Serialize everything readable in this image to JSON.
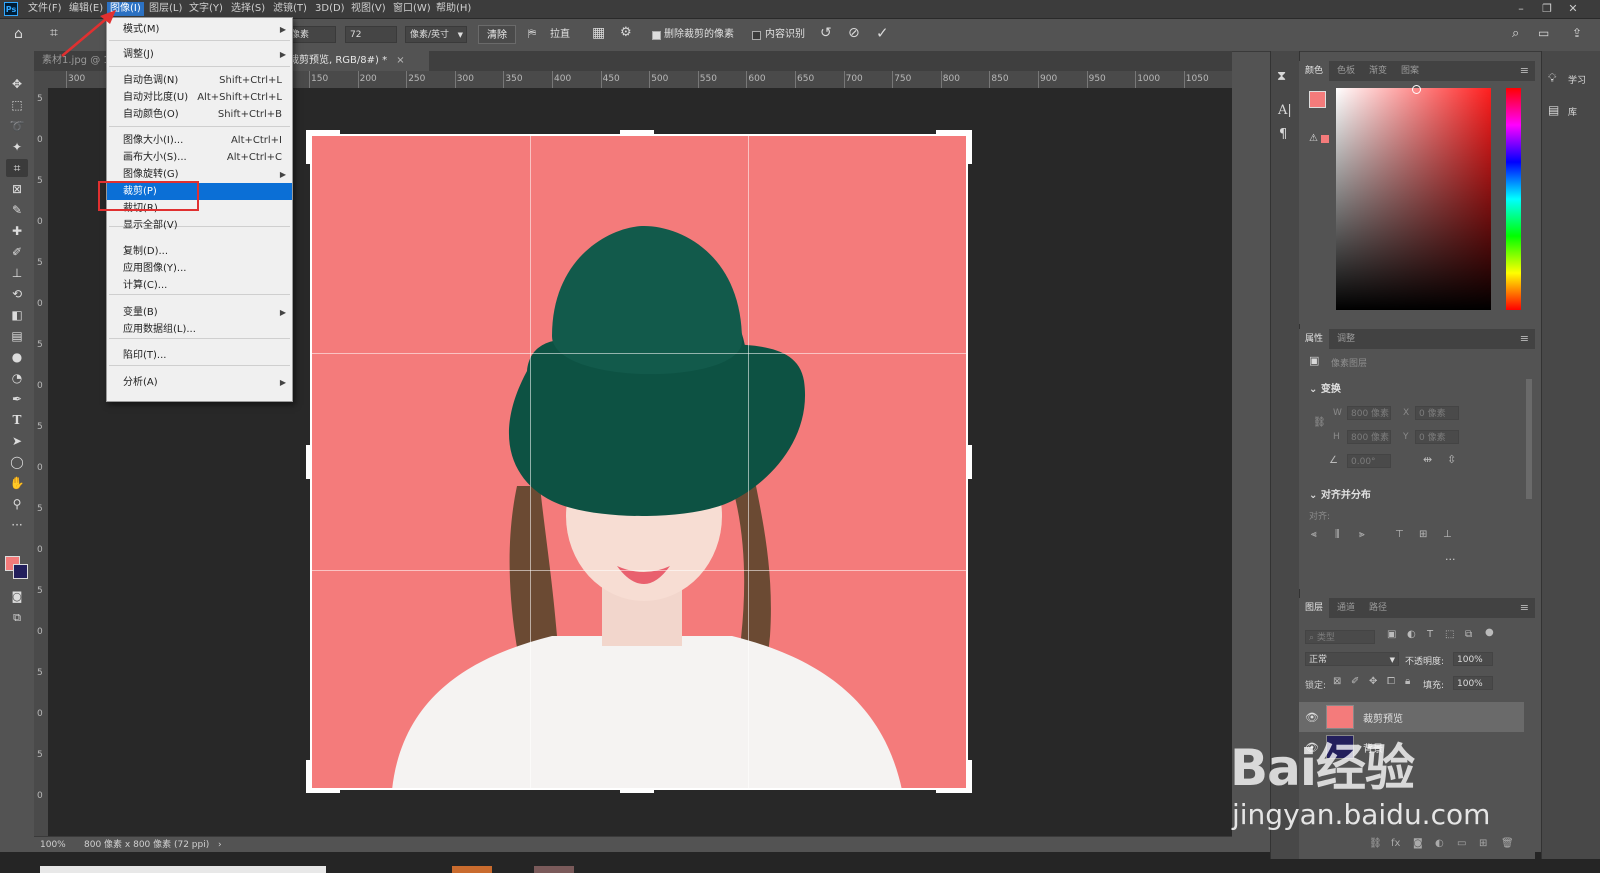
{
  "app": {
    "logo": "Ps"
  },
  "menubar": {
    "items": [
      "文件(F)",
      "编辑(E)",
      "图像(I)",
      "图层(L)",
      "文字(Y)",
      "选择(S)",
      "滤镜(T)",
      "3D(D)",
      "视图(V)",
      "窗口(W)",
      "帮助(H)"
    ],
    "active_index": 2
  },
  "options_bar": {
    "unit_field": "像素",
    "resolution": "72",
    "resolution_unit": "像素/英寸",
    "clear_label": "清除",
    "straighten_label": "拉直",
    "delete_cropped_label": "删除裁剪的像素",
    "delete_cropped_checked": true,
    "content_aware_label": "内容识别",
    "content_aware_checked": false
  },
  "doc_tabs": [
    {
      "label": "素材1.jpg @ 1",
      "active": false
    },
    {
      "label": "裁剪预览, RGB/8#) *",
      "active": true
    }
  ],
  "tab_close": "×",
  "ruler": {
    "h_labels": [
      "300",
      "50",
      "0",
      "50",
      "100",
      "150",
      "200",
      "250",
      "300",
      "350",
      "400",
      "450",
      "500",
      "550",
      "600",
      "650",
      "700",
      "750",
      "800",
      "850",
      "900",
      "950",
      "1000",
      "1050",
      "110"
    ],
    "v_labels": [
      "5",
      "0",
      "5",
      "0",
      "5",
      "0",
      "5",
      "0",
      "5",
      "0",
      "5",
      "0",
      "5",
      "0",
      "5",
      "0",
      "5",
      "0"
    ]
  },
  "image_menu": {
    "items": [
      {
        "label": "模式(M)",
        "shortcut": "",
        "submenu": true
      },
      {
        "label": "调整(J)",
        "shortcut": "",
        "submenu": true
      },
      {
        "label": "自动色调(N)",
        "shortcut": "Shift+Ctrl+L"
      },
      {
        "label": "自动对比度(U)",
        "shortcut": "Alt+Shift+Ctrl+L"
      },
      {
        "label": "自动颜色(O)",
        "shortcut": "Shift+Ctrl+B"
      },
      {
        "label": "图像大小(I)...",
        "shortcut": "Alt+Ctrl+I"
      },
      {
        "label": "画布大小(S)...",
        "shortcut": "Alt+Ctrl+C"
      },
      {
        "label": "图像旋转(G)",
        "shortcut": "",
        "submenu": true
      },
      {
        "label": "裁剪(P)",
        "shortcut": "",
        "highlighted": true
      },
      {
        "label": "裁切(R)...",
        "shortcut": ""
      },
      {
        "label": "显示全部(V)",
        "shortcut": ""
      },
      {
        "label": "复制(D)...",
        "shortcut": ""
      },
      {
        "label": "应用图像(Y)...",
        "shortcut": ""
      },
      {
        "label": "计算(C)...",
        "shortcut": ""
      },
      {
        "label": "变量(B)",
        "shortcut": "",
        "submenu": true
      },
      {
        "label": "应用数据组(L)...",
        "shortcut": ""
      },
      {
        "label": "陷印(T)...",
        "shortcut": ""
      },
      {
        "label": "分析(A)",
        "shortcut": "",
        "submenu": true
      }
    ],
    "submenu_arrow": "▶"
  },
  "color_panel": {
    "tabs": [
      "颜色",
      "色板",
      "渐变",
      "图案"
    ],
    "foreground": "#f47b7b",
    "background": "#231f5c"
  },
  "properties_panel": {
    "tabs": [
      "属性",
      "调整"
    ],
    "layer_type": "像素图层",
    "transform_title": "变换",
    "w_label": "W",
    "w_value": "800 像素",
    "h_label": "H",
    "h_value": "800 像素",
    "x_label": "X",
    "x_value": "0 像素",
    "y_label": "Y",
    "y_value": "0 像素",
    "angle_value": "0.00°",
    "align_title": "对齐并分布",
    "align_label": "对齐:",
    "more": "···"
  },
  "layers_panel": {
    "tabs": [
      "图层",
      "通道",
      "路径"
    ],
    "search_placeholder": "类型",
    "blend_mode": "正常",
    "opacity_label": "不透明度:",
    "opacity_value": "100%",
    "lock_label": "锁定:",
    "fill_label": "填充:",
    "fill_value": "100%",
    "layers": [
      "裁剪预览",
      "背景"
    ]
  },
  "right_strip": {
    "learn_label": "学习",
    "library_label": "库"
  },
  "status": {
    "zoom": "100%",
    "info": "800 像素 x 800 像素 (72 ppi)",
    "arrow": "›"
  },
  "watermark": {
    "line1": "Bai经验",
    "line2": "jingyan.baidu.com"
  },
  "colors": {
    "accent": "#0b6fd6",
    "annotation_red": "#e03030",
    "photo_bg": "#f47b7b",
    "hat": "#0f4e42"
  }
}
